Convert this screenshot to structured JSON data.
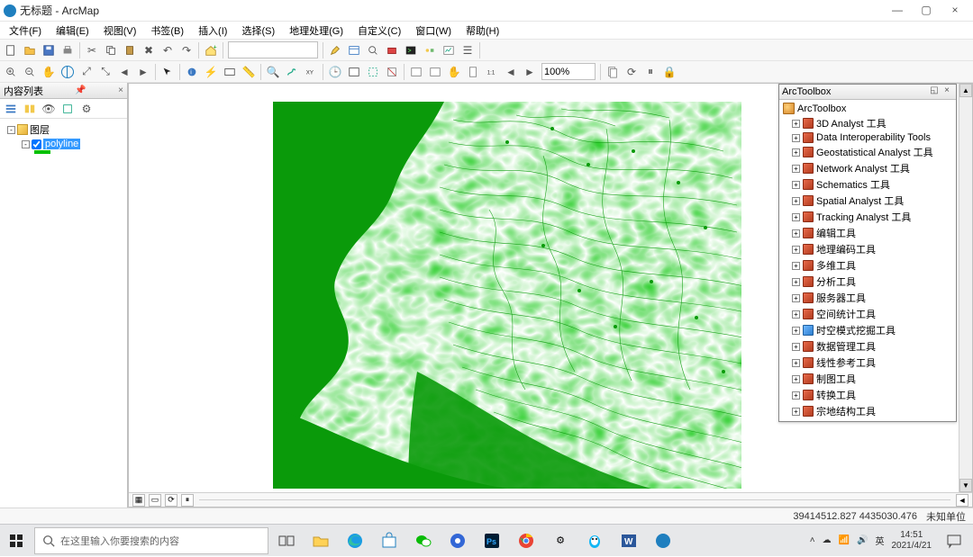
{
  "window": {
    "title": "无标题 - ArcMap",
    "min": "—",
    "max": "▢",
    "close": "×"
  },
  "menu": [
    "文件(F)",
    "编辑(E)",
    "视图(V)",
    "书签(B)",
    "插入(I)",
    "选择(S)",
    "地理处理(G)",
    "自定义(C)",
    "窗口(W)",
    "帮助(H)"
  ],
  "toolbars": {
    "scale_combo": "",
    "zoom_pct": "100%"
  },
  "toc": {
    "title": "内容列表",
    "root": "图层",
    "layer": "polyline"
  },
  "arctoolbox": {
    "title": "ArcToolbox",
    "root": "ArcToolbox",
    "items": [
      {
        "label": "3D Analyst 工具",
        "kind": "red"
      },
      {
        "label": "Data Interoperability Tools",
        "kind": "red"
      },
      {
        "label": "Geostatistical Analyst 工具",
        "kind": "red"
      },
      {
        "label": "Network Analyst 工具",
        "kind": "red"
      },
      {
        "label": "Schematics 工具",
        "kind": "red"
      },
      {
        "label": "Spatial Analyst 工具",
        "kind": "red"
      },
      {
        "label": "Tracking Analyst 工具",
        "kind": "red"
      },
      {
        "label": "编辑工具",
        "kind": "red"
      },
      {
        "label": "地理编码工具",
        "kind": "red"
      },
      {
        "label": "多维工具",
        "kind": "red"
      },
      {
        "label": "分析工具",
        "kind": "red"
      },
      {
        "label": "服务器工具",
        "kind": "red"
      },
      {
        "label": "空间统计工具",
        "kind": "red"
      },
      {
        "label": "时空模式挖掘工具",
        "kind": "blue"
      },
      {
        "label": "数据管理工具",
        "kind": "red"
      },
      {
        "label": "线性参考工具",
        "kind": "red"
      },
      {
        "label": "制图工具",
        "kind": "red"
      },
      {
        "label": "转换工具",
        "kind": "red"
      },
      {
        "label": "宗地结构工具",
        "kind": "red"
      }
    ]
  },
  "status": {
    "coords": "39414512.827  4435030.476",
    "units": "未知单位"
  },
  "taskbar": {
    "search_placeholder": "在这里输入你要搜索的内容",
    "ime1": "英",
    "time": "14:51",
    "date": "2021/4/21"
  }
}
